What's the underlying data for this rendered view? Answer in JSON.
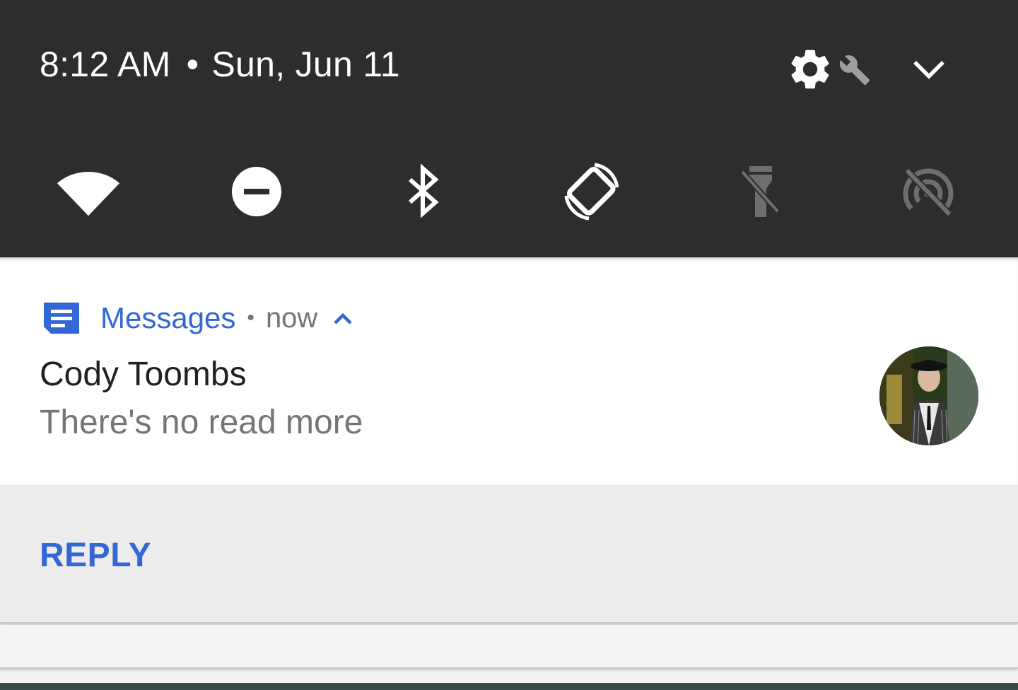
{
  "header": {
    "time": "8:12 AM",
    "separator": "•",
    "date": "Sun, Jun 11",
    "icons": [
      "gear-icon",
      "wrench-icon",
      "chevron-down-icon"
    ]
  },
  "quick_settings": [
    {
      "name": "wifi",
      "icon": "wifi-icon",
      "state": "on"
    },
    {
      "name": "do-not-disturb",
      "icon": "do-not-disturb-icon",
      "state": "on"
    },
    {
      "name": "bluetooth",
      "icon": "bluetooth-icon",
      "state": "on"
    },
    {
      "name": "auto-rotate",
      "icon": "auto-rotate-icon",
      "state": "on"
    },
    {
      "name": "flashlight",
      "icon": "flashlight-off-icon",
      "state": "off"
    },
    {
      "name": "hotspot",
      "icon": "hotspot-off-icon",
      "state": "off"
    }
  ],
  "notification": {
    "app_name": "Messages",
    "separator": "•",
    "time": "now",
    "sender": "Cody Toombs",
    "message": "There's no read more",
    "action": "REPLY"
  },
  "colors": {
    "shade_bg": "#2d2d2d",
    "accent": "#3367d6",
    "secondary_text": "#757575",
    "primary_text": "#212121",
    "actions_bg": "#ececec",
    "disabled_icon": "#6e6e6e"
  }
}
